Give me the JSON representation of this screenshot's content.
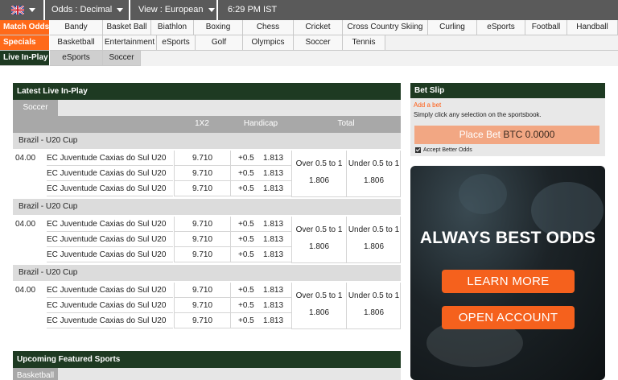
{
  "topbar": {
    "odds_label": "Odds : Decimal",
    "view_label": "View : European",
    "time": "6:29 PM IST"
  },
  "categories": {
    "row1_side": "Match Odds",
    "row2_side": "Specials",
    "row3_side": "Live In-Play",
    "row1": [
      "Bandy",
      "Basket Ball",
      "Biathlon",
      "Boxing",
      "Chess",
      "Cricket",
      "Cross Country Skiing",
      "Curling",
      "eSports",
      "Football",
      "Handball"
    ],
    "row2": [
      "Basketball",
      "Entertainment",
      "eSports",
      "Golf",
      "Olympics",
      "Soccer",
      "Tennis"
    ],
    "row3": [
      "eSports",
      "Soccer"
    ]
  },
  "live": {
    "title": "Latest Live In-Play",
    "sport_tab": "Soccer",
    "col_1x2": "1X2",
    "col_handicap": "Handicap",
    "col_total": "Total",
    "groups": [
      {
        "league": "Brazil - U20 Cup",
        "time": "04.00",
        "rows": [
          {
            "team": "EC Juventude Caxias do Sul U20",
            "odds": "9.710",
            "hcp": "+0.5",
            "hcp_odds": "1.813"
          },
          {
            "team": "EC Juventude Caxias do Sul U20",
            "odds": "9.710",
            "hcp": "+0.5",
            "hcp_odds": "1.813"
          },
          {
            "team": "EC Juventude Caxias do Sul U20",
            "odds": "9.710",
            "hcp": "+0.5",
            "hcp_odds": "1.813"
          }
        ],
        "over": "Over 0.5 to 1",
        "over_odds": "1.806",
        "under": "Under 0.5 to 1",
        "under_odds": "1.806"
      },
      {
        "league": "Brazil - U20 Cup",
        "time": "04.00",
        "rows": [
          {
            "team": "EC Juventude Caxias do Sul U20",
            "odds": "9.710",
            "hcp": "+0.5",
            "hcp_odds": "1.813"
          },
          {
            "team": "EC Juventude Caxias do Sul U20",
            "odds": "9.710",
            "hcp": "+0.5",
            "hcp_odds": "1.813"
          },
          {
            "team": "EC Juventude Caxias do Sul U20",
            "odds": "9.710",
            "hcp": "+0.5",
            "hcp_odds": "1.813"
          }
        ],
        "over": "Over 0.5 to 1",
        "over_odds": "1.806",
        "under": "Under 0.5 to 1",
        "under_odds": "1.806"
      },
      {
        "league": "Brazil - U20 Cup",
        "time": "04.00",
        "rows": [
          {
            "team": "EC Juventude Caxias do Sul U20",
            "odds": "9.710",
            "hcp": "+0.5",
            "hcp_odds": "1.813"
          },
          {
            "team": "EC Juventude Caxias do Sul U20",
            "odds": "9.710",
            "hcp": "+0.5",
            "hcp_odds": "1.813"
          },
          {
            "team": "EC Juventude Caxias do Sul U20",
            "odds": "9.710",
            "hcp": "+0.5",
            "hcp_odds": "1.813"
          }
        ],
        "over": "Over 0.5 to 1",
        "over_odds": "1.806",
        "under": "Under 0.5 to 1",
        "under_odds": "1.806"
      }
    ]
  },
  "upcoming": {
    "title": "Upcoming Featured Sports",
    "sport_tab": "Basketball"
  },
  "betslip": {
    "title": "Bet Slip",
    "add_bet": "Add a bet",
    "info": "Simply click any selection on the sportsbook.",
    "place_bet": "Place Bet",
    "amount": "BTC 0.0000",
    "accept": "Accept Better Odds"
  },
  "promo": {
    "title": "ALWAYS BEST ODDS",
    "learn_more": "LEARN MORE",
    "open_account": "OPEN ACCOUNT"
  },
  "colors": {
    "accent": "#ff6a1a",
    "dark_green": "#1e3a22",
    "topbar": "#5a5a5a",
    "button_orange": "#f5611d"
  },
  "icons": {
    "language": "uk-flag-icon",
    "dropdown": "caret-down-icon",
    "checkbox": "checkbox-checked-icon"
  }
}
